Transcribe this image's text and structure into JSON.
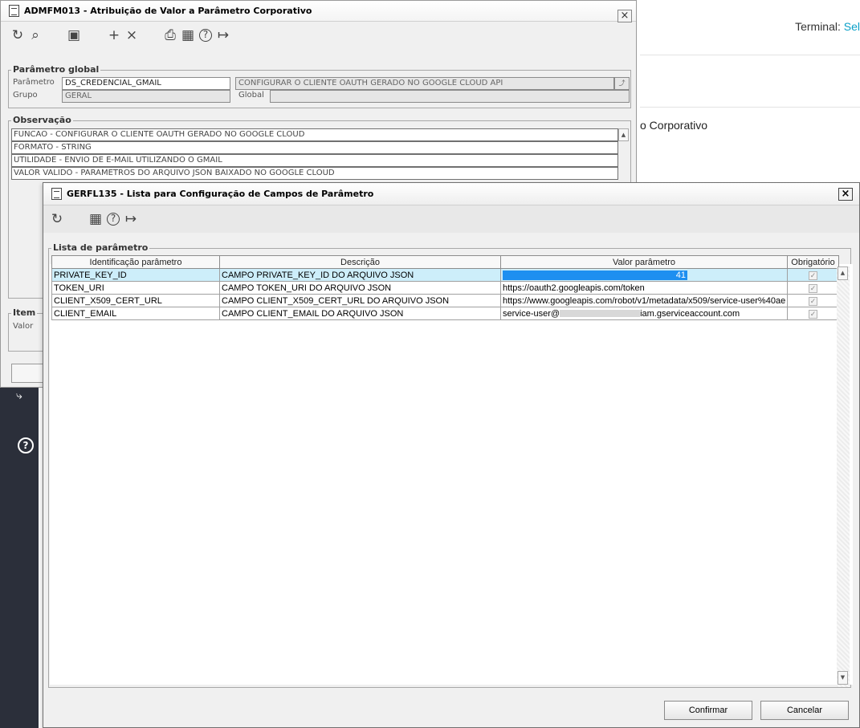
{
  "background": {
    "terminal_label": "Terminal:",
    "terminal_value": "Sel",
    "page_title_fragment": "o Corporativo",
    "side_link_icon": "link-icon",
    "side_help_icon": "help-icon"
  },
  "window1": {
    "title": "ADMFM013 - Atribuição de Valor a Parâmetro Corporativo",
    "close_label": "×",
    "toolbar": {
      "refresh_icon": "↻",
      "search_icon": "⌕",
      "save_icon": "💾",
      "add_icon": "+",
      "delete_icon": "×",
      "print_icon": "🖶",
      "calendar_icon": "▦",
      "help_icon": "?",
      "exit_icon": "↦"
    },
    "global_group": {
      "label": "Parâmetro global",
      "param_label": "Parâmetro",
      "param_value": "DS_CREDENCIAL_GMAIL",
      "param_desc": "CONFIGURAR O CLIENTE OAUTH GERADO NO GOOGLE CLOUD API",
      "group_label": "Grupo",
      "group_value": "GERAL",
      "global_label": "Global",
      "global_value": ""
    },
    "obs_group": {
      "label": "Observação",
      "lines": [
        "FUNCAO - CONFIGURAR O CLIENTE OAUTH GERADO NO GOOGLE CLOUD",
        "FORMATO - STRING",
        "UTILIDADE - ENVIO DE E-MAIL UTILIZANDO O GMAIL",
        "VALOR VALIDO - PARAMETROS DO ARQUIVO JSON BAIXADO NO GOOGLE CLOUD"
      ]
    },
    "item_group": {
      "label": "Item",
      "value_label": "Valor"
    }
  },
  "window2": {
    "title": "GERFL135 - Lista para Configuração de Campos de Parâmetro",
    "close_label": "×",
    "group_label": "Lista de parâmetro",
    "columns": [
      "Identificação parâmetro",
      "Descrição",
      "Valor parâmetro",
      "Obrigatório"
    ],
    "rows": [
      {
        "id": "PRIVATE_KEY_ID",
        "desc": "CAMPO PRIVATE_KEY_ID DO ARQUIVO JSON",
        "value": "41",
        "required": true
      },
      {
        "id": "TOKEN_URI",
        "desc": "CAMPO TOKEN_URI DO ARQUIVO JSON",
        "value": "https://oauth2.googleapis.com/token",
        "required": true
      },
      {
        "id": "CLIENT_X509_CERT_URL",
        "desc": "CAMPO CLIENT_X509_CERT_URL DO ARQUIVO JSON",
        "value": "https://www.googleapis.com/robot/v1/metadata/x509/service-user%40ae",
        "required": true
      },
      {
        "id": "CLIENT_EMAIL",
        "desc": "CAMPO CLIENT_EMAIL DO ARQUIVO JSON",
        "value": "service-user@",
        "value_tail": "iam.gserviceaccount.com",
        "required": true
      }
    ],
    "confirm_label": "Confirmar",
    "cancel_label": "Cancelar"
  }
}
